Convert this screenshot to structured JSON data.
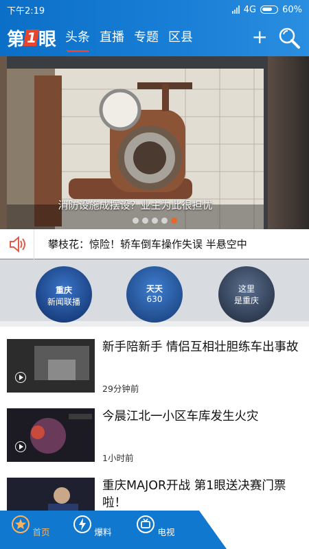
{
  "status_bar": {
    "time": "下午2:19",
    "network": "4G",
    "battery": "60%"
  },
  "header": {
    "logo_a": "第",
    "logo_one": "1",
    "logo_b": "眼",
    "tabs": [
      {
        "label": "头条",
        "active": true
      },
      {
        "label": "直播",
        "active": false
      },
      {
        "label": "专题",
        "active": false
      },
      {
        "label": "区县",
        "active": false
      }
    ],
    "actions": [
      "plus-icon",
      "search-icon"
    ]
  },
  "banner": {
    "caption": "消防设施成摆设？业主为此很担忧",
    "slide_count": 5,
    "active_slide": 5
  },
  "ticker": {
    "icon": "speaker-icon",
    "text": "攀枝花：惊险！轿车倒车操作失误 半悬空中"
  },
  "channels": [
    {
      "line1": "重庆",
      "line2": "新闻联播"
    },
    {
      "line1": "天天",
      "line2": "630"
    },
    {
      "line1": "这里",
      "line2": "是重庆"
    }
  ],
  "news": [
    {
      "title": "新手陪新手 情侣互相壮胆练车出事故",
      "time": "29分钟前",
      "video": true
    },
    {
      "title": "今晨江北一小区车库发生火灾",
      "time": "1小时前",
      "video": true
    },
    {
      "title": "重庆MAJOR开战 第1眼送决赛门票啦！",
      "time": "",
      "video": false
    }
  ],
  "bottom_nav": [
    {
      "label": "首页",
      "icon": "star-icon",
      "active": true
    },
    {
      "label": "爆料",
      "icon": "lightning-icon",
      "active": false
    },
    {
      "label": "电视",
      "icon": "tv-icon",
      "active": false
    }
  ],
  "colors": {
    "header_blue": "#1a7fd6",
    "accent_red": "#e8452c",
    "active_orange": "#ffb25c"
  }
}
